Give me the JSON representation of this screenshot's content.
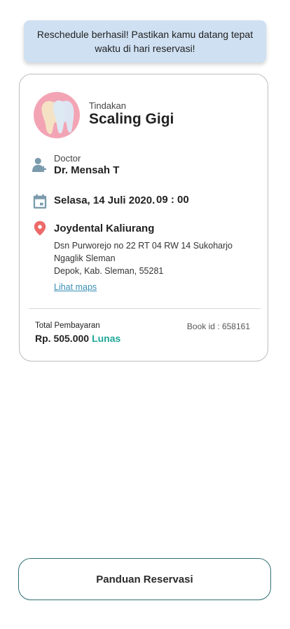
{
  "toast": {
    "line1": "Reschedule berhasil! Pastikan kamu datang tepat",
    "line2": "waktu di hari reservasi!"
  },
  "treatment": {
    "label": "Tindakan",
    "title": "Scaling Gigi",
    "icon": "tooth-icon"
  },
  "doctor": {
    "label": "Doctor",
    "name": "Dr. Mensah T",
    "icon": "doctor-add-icon"
  },
  "schedule": {
    "date": "Selasa, 14 Juli 2020.",
    "time": "09 : 00",
    "icon": "calendar-icon"
  },
  "location": {
    "name": "Joydental Kaliurang",
    "address_lines": [
      "Dsn Purworejo no 22 RT 04 RW 14 Sukoharjo",
      "Ngaglik Sleman",
      "Depok, Kab. Sleman, 55281"
    ],
    "maps_link": "Lihat maps",
    "icon": "location-pin-icon"
  },
  "payment": {
    "label": "Total Pembayaran",
    "amount": "Rp. 505.000",
    "status": "Lunas",
    "book_id": "Book id : 658161"
  },
  "guide_button": "Panduan Reservasi",
  "colors": {
    "toast_bg": "#cfe0f2",
    "accent_teal": "#1fa89a",
    "link": "#3a8fb7",
    "icon_grey": "#7b9bad",
    "pin_red": "#ec6a6a",
    "avatar_pink": "#f3a4b4"
  }
}
